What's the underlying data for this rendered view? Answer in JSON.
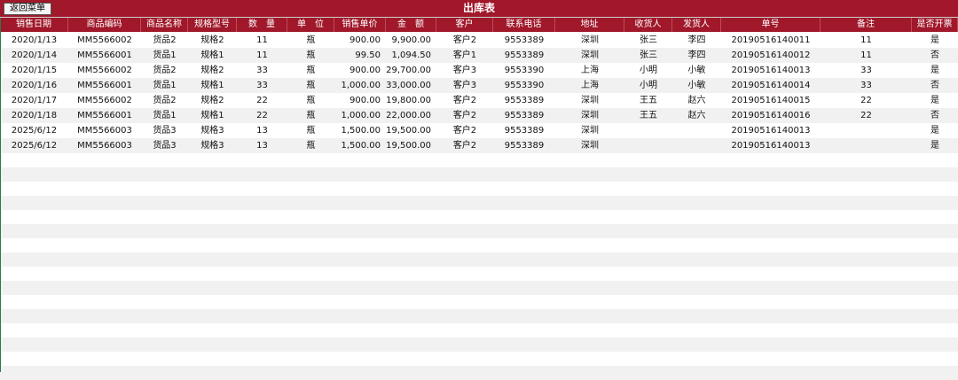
{
  "title": "出库表",
  "back_button": "返回菜单",
  "columns": [
    "销售日期",
    "商品编码",
    "商品名称",
    "规格型号",
    "数　量",
    "单　位",
    "销售单价",
    "金　额",
    "客户",
    "联系电话",
    "地址",
    "收货人",
    "发货人",
    "单号",
    "备注",
    "是否开票"
  ],
  "rows": [
    [
      "2020/1/13",
      "MM5566002",
      "货品2",
      "规格2",
      "11",
      "瓶",
      "900.00",
      "9,900.00",
      "客户2",
      "9553389",
      "深圳",
      "张三",
      "李四",
      "20190516140011",
      "11",
      "是"
    ],
    [
      "2020/1/14",
      "MM5566001",
      "货品1",
      "规格1",
      "11",
      "瓶",
      "99.50",
      "1,094.50",
      "客户1",
      "9553389",
      "深圳",
      "张三",
      "李四",
      "20190516140012",
      "11",
      "否"
    ],
    [
      "2020/1/15",
      "MM5566002",
      "货品2",
      "规格2",
      "33",
      "瓶",
      "900.00",
      "29,700.00",
      "客户3",
      "9553390",
      "上海",
      "小明",
      "小敏",
      "20190516140013",
      "33",
      "是"
    ],
    [
      "2020/1/16",
      "MM5566001",
      "货品1",
      "规格1",
      "33",
      "瓶",
      "1,000.00",
      "33,000.00",
      "客户3",
      "9553390",
      "上海",
      "小明",
      "小敏",
      "20190516140014",
      "33",
      "否"
    ],
    [
      "2020/1/17",
      "MM5566002",
      "货品2",
      "规格2",
      "22",
      "瓶",
      "900.00",
      "19,800.00",
      "客户2",
      "9553389",
      "深圳",
      "王五",
      "赵六",
      "20190516140015",
      "22",
      "是"
    ],
    [
      "2020/1/18",
      "MM5566001",
      "货品1",
      "规格1",
      "22",
      "瓶",
      "1,000.00",
      "22,000.00",
      "客户2",
      "9553389",
      "深圳",
      "王五",
      "赵六",
      "20190516140016",
      "22",
      "否"
    ],
    [
      "2025/6/12",
      "MM5566003",
      "货品3",
      "规格3",
      "13",
      "瓶",
      "1,500.00",
      "19,500.00",
      "客户2",
      "9553389",
      "深圳",
      "",
      "",
      "20190516140013",
      "",
      "是"
    ],
    [
      "2025/6/12",
      "MM5566003",
      "货品3",
      "规格3",
      "13",
      "瓶",
      "1,500.00",
      "19,500.00",
      "客户2",
      "9553389",
      "深圳",
      "",
      "",
      "20190516140013",
      "",
      "是"
    ]
  ],
  "colors": {
    "header_bg": "#a0182a",
    "header_text": "#ffffff",
    "band": "#f1f1f1"
  }
}
